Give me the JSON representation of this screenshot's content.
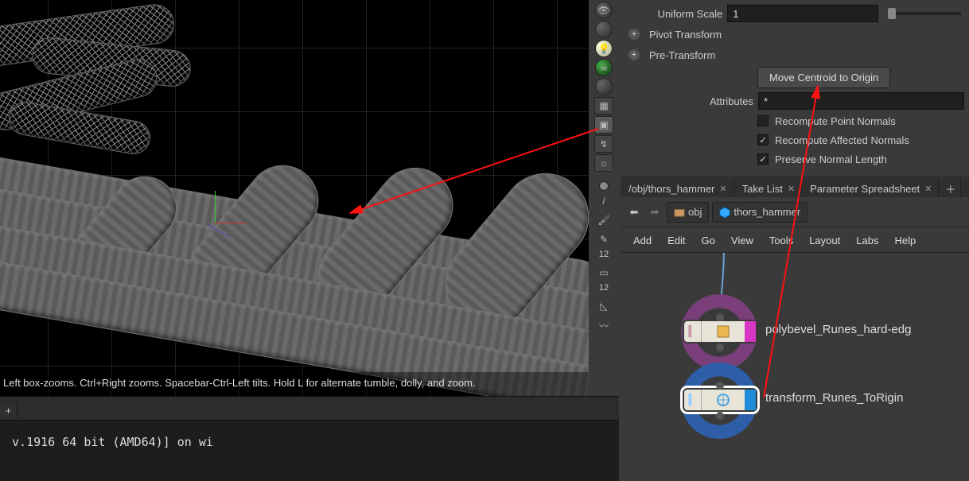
{
  "params": {
    "uniform_scale_label": "Uniform Scale",
    "uniform_scale_value": "1",
    "pivot_label": "Pivot Transform",
    "pretrans_label": "Pre-Transform",
    "move_centroid_label": "Move Centroid to Origin",
    "attributes_label": "Attributes",
    "attributes_value": "*",
    "chk_recompute_point": "Recompute Point Normals",
    "chk_recompute_affected": "Recompute Affected Normals",
    "chk_preserve_len": "Preserve Normal Length"
  },
  "tabs": {
    "path": "/obj/thors_hammer",
    "take": "Take List",
    "spread": "Parameter Spreadsheet"
  },
  "pathbar": {
    "obj": "obj",
    "node": "thors_hammer"
  },
  "menu": {
    "add": "Add",
    "edit": "Edit",
    "go": "Go",
    "view": "View",
    "tools": "Tools",
    "layout": "Layout",
    "labs": "Labs",
    "help": "Help"
  },
  "nodes": {
    "polybevel": "polybevel_Runes_hard-edg",
    "transform": "transform_Runes_ToRigin"
  },
  "hint": "Left box-zooms. Ctrl+Right zooms. Spacebar-Ctrl-Left tilts. Hold L for alternate tumble, dolly, and zoom.",
  "console": " v.1916 64 bit (AMD64)] on wi",
  "vtool": {
    "num12": "12"
  },
  "plus": "+"
}
